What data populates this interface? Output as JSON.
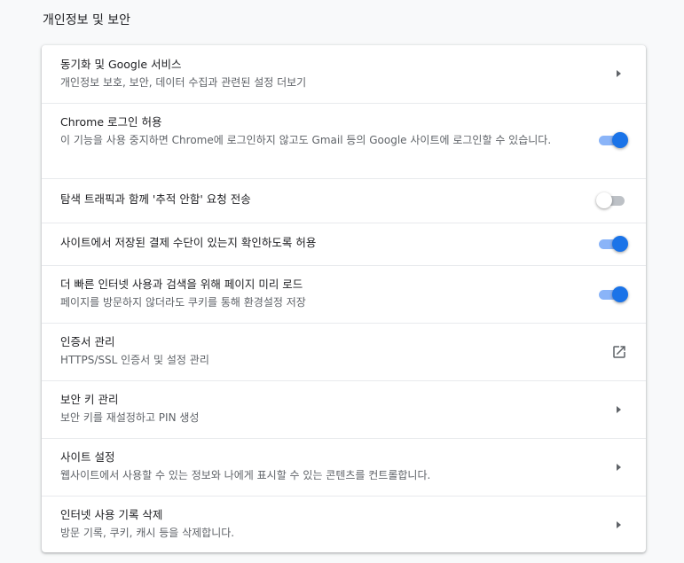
{
  "section": {
    "title": "개인정보 및 보안"
  },
  "rows": [
    {
      "label": "동기화 및 Google 서비스",
      "sub": "개인정보 보호, 보안, 데이터 수집과 관련된 설정 더보기",
      "control": "arrow"
    },
    {
      "label": "Chrome 로그인 허용",
      "sub": "이 기능을 사용 중지하면 Chrome에 로그인하지 않고도 Gmail 등의 Google 사이트에 로그인할 수 있습니다.",
      "control": "toggle",
      "checked": true
    },
    {
      "label": "탐색 트래픽과 함께 '추적 안함' 요청 전송",
      "control": "toggle",
      "checked": false
    },
    {
      "label": "사이트에서 저장된 결제 수단이 있는지 확인하도록 허용",
      "control": "toggle",
      "checked": true
    },
    {
      "label": "더 빠른 인터넷 사용과 검색을 위해 페이지 미리 로드",
      "sub": "페이지를 방문하지 않더라도 쿠키를 통해 환경설정 저장",
      "control": "toggle",
      "checked": true
    },
    {
      "label": "인증서 관리",
      "sub": "HTTPS/SSL 인증서 및 설정 관리",
      "control": "external-link"
    },
    {
      "label": "보안 키 관리",
      "sub": "보안 키를 재설정하고 PIN 생성",
      "control": "arrow"
    },
    {
      "label": "사이트 설정",
      "sub": "웹사이트에서 사용할 수 있는 정보와 나에게 표시할 수 있는 콘텐츠를 컨트롤합니다.",
      "control": "arrow"
    },
    {
      "label": "인터넷 사용 기록 삭제",
      "sub": "방문 기록, 쿠키, 캐시 등을 삭제합니다.",
      "control": "arrow"
    }
  ],
  "colors": {
    "toggle_on_knob": "#1a73e8",
    "toggle_on_track": "#8ab4f8",
    "toggle_off_track": "#bdc1c6",
    "card_bg": "#ffffff",
    "page_bg": "#f8f9fa"
  }
}
